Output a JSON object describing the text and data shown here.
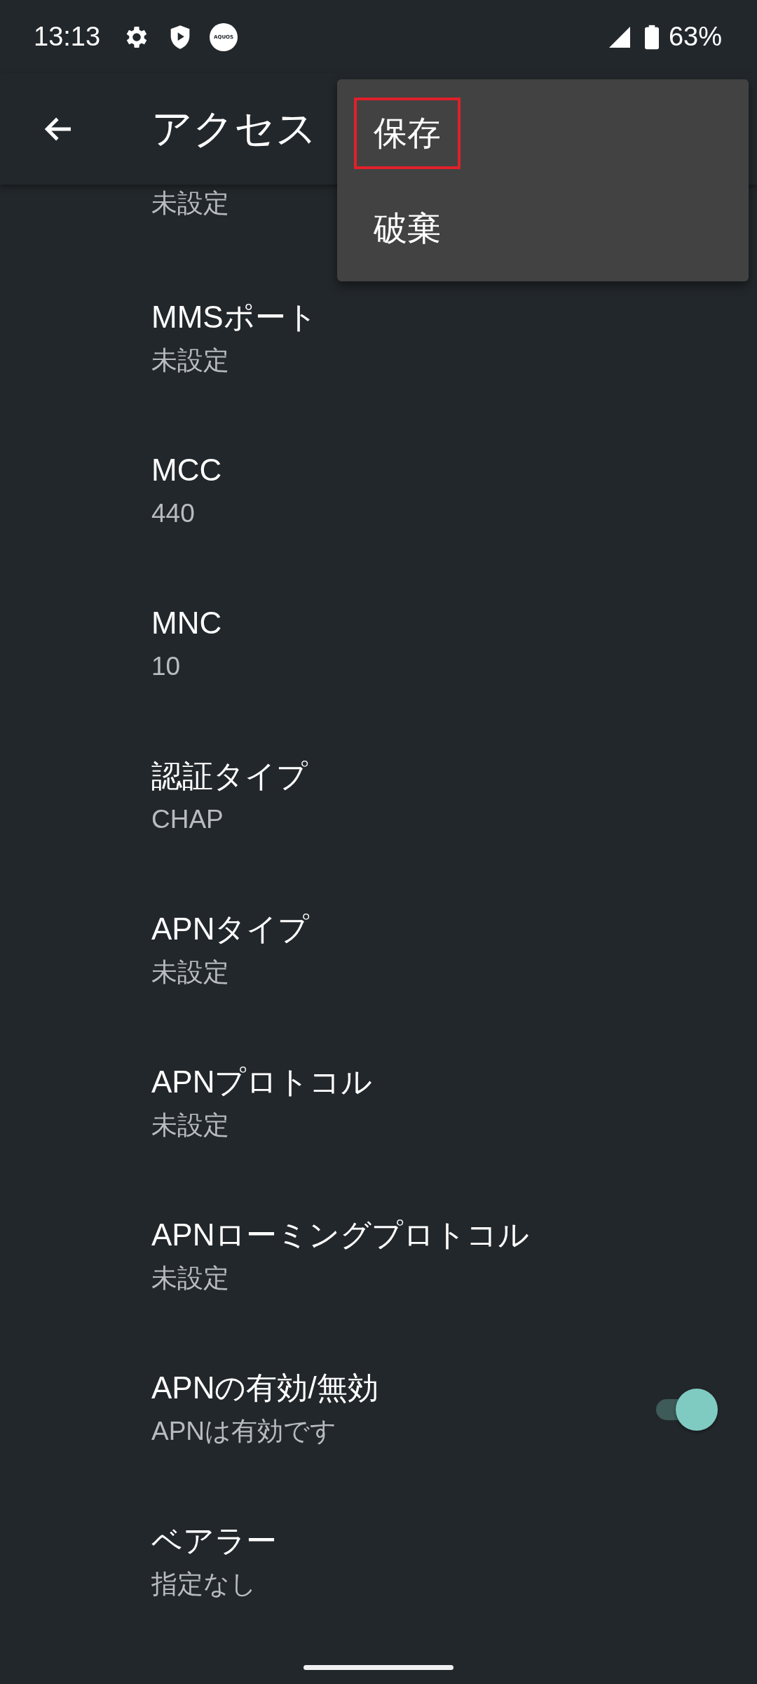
{
  "status_bar": {
    "time": "13:13",
    "badge": "AQUOS",
    "battery": "63%"
  },
  "app_bar": {
    "title": "アクセス"
  },
  "menu": {
    "items": [
      {
        "label": "保存",
        "highlighted": true
      },
      {
        "label": "破棄",
        "highlighted": false
      }
    ]
  },
  "settings": [
    {
      "kind": "text",
      "summary": "未設定"
    },
    {
      "kind": "text",
      "title": "MMSポート",
      "summary": "未設定"
    },
    {
      "kind": "text",
      "title": "MCC",
      "summary": "440"
    },
    {
      "kind": "text",
      "title": "MNC",
      "summary": "10"
    },
    {
      "kind": "text",
      "title": "認証タイプ",
      "summary": "CHAP"
    },
    {
      "kind": "text",
      "title": "APNタイプ",
      "summary": "未設定"
    },
    {
      "kind": "text",
      "title": "APNプロトコル",
      "summary": "未設定"
    },
    {
      "kind": "text",
      "title": "APNローミングプロトコル",
      "summary": "未設定"
    },
    {
      "kind": "switch",
      "title": "APNの有効/無効",
      "summary": "APNは有効です",
      "on": true
    },
    {
      "kind": "text",
      "title": "ベアラー",
      "summary": "指定なし"
    }
  ]
}
